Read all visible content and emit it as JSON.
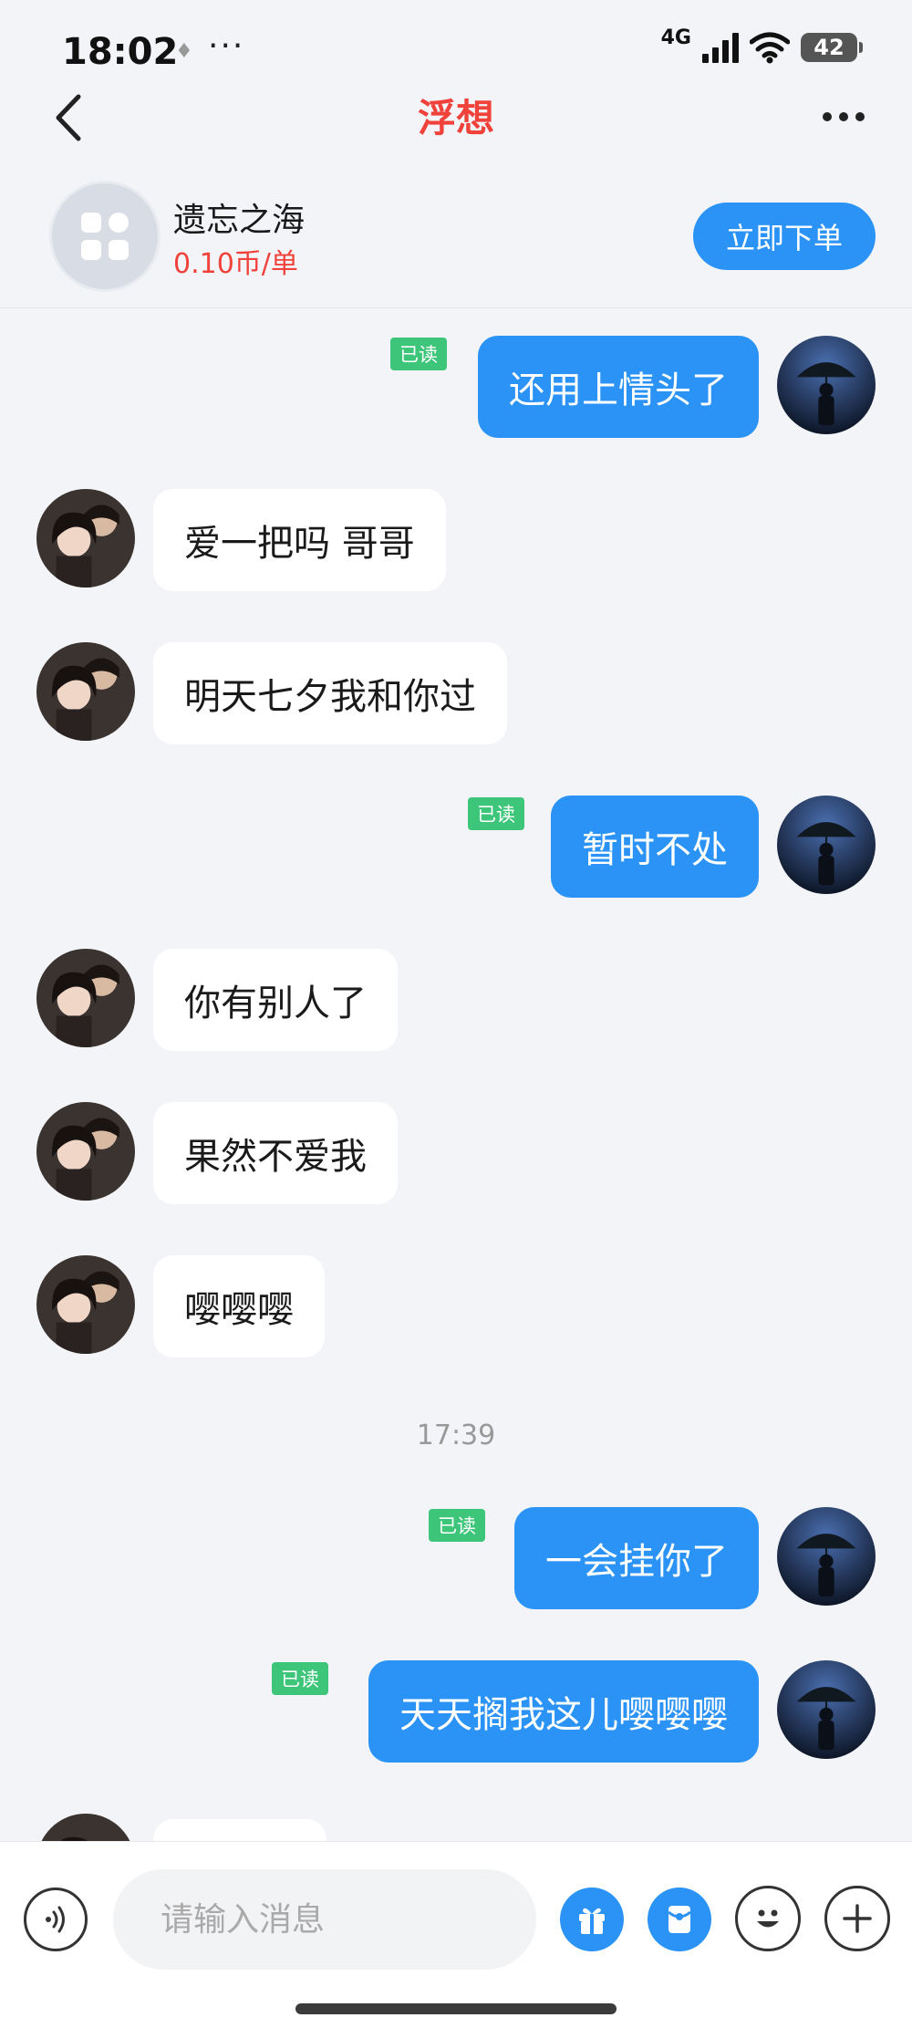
{
  "status_bar": {
    "time": "18:02",
    "network": "4G",
    "battery": "42"
  },
  "nav": {
    "title": "浮想"
  },
  "order": {
    "name": "遗忘之海",
    "price": "0.10币/单",
    "button_label": "立即下单"
  },
  "messages": [
    {
      "side": "out",
      "text": "还用上情头了",
      "read": "已读"
    },
    {
      "side": "in",
      "text": "爱一把吗 哥哥"
    },
    {
      "side": "in",
      "text": "明天七夕我和你过"
    },
    {
      "side": "out",
      "text": "暂时不处",
      "read": "已读"
    },
    {
      "side": "in",
      "text": "你有别人了"
    },
    {
      "side": "in",
      "text": "果然不爱我"
    },
    {
      "side": "in",
      "text": "嘤嘤嘤"
    },
    {
      "side": "out",
      "text": "一会挂你了",
      "read": "已读"
    },
    {
      "side": "out",
      "text": "天天搁我这儿嘤嘤嘤",
      "read": "已读"
    }
  ],
  "timestamp": "17:39",
  "input": {
    "placeholder": "请输入消息"
  },
  "colors": {
    "accent": "#2b93f5",
    "title_red": "#f0413a",
    "read_green": "#3dc57a",
    "background": "#f2f4f7"
  }
}
